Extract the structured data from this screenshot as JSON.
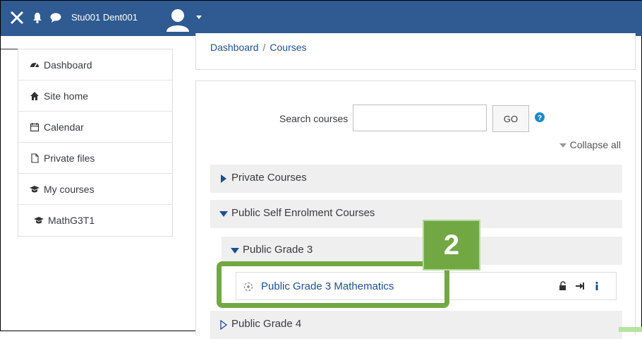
{
  "navbar": {
    "user_name": "Stu001 Dent001",
    "icons": [
      "close-icon",
      "bell-icon",
      "chat-icon",
      "avatar-icon",
      "caret-down-icon"
    ],
    "background": "#2f5a92"
  },
  "sidebar": {
    "items": [
      {
        "label": "Dashboard",
        "icon": "dashboard-icon"
      },
      {
        "label": "Site home",
        "icon": "home-icon"
      },
      {
        "label": "Calendar",
        "icon": "calendar-icon"
      },
      {
        "label": "Private files",
        "icon": "file-icon"
      },
      {
        "label": "My courses",
        "icon": "graduation-cap-icon"
      },
      {
        "label": "MathG3T1",
        "icon": "graduation-cap-icon"
      }
    ]
  },
  "breadcrumb": {
    "items": [
      "Dashboard",
      "Courses"
    ],
    "separator": "/"
  },
  "search": {
    "label": "Search courses",
    "value": "",
    "go_label": "GO"
  },
  "collapse_all": "Collapse all",
  "categories": [
    {
      "label": "Private Courses",
      "expanded": false
    },
    {
      "label": "Public Self Enrolment Courses",
      "expanded": true
    },
    {
      "label": "Public Grade 3",
      "expanded": true
    },
    {
      "label": "Public Grade 4",
      "expanded": false
    }
  ],
  "course": {
    "name": "Public Grade 3 Mathematics",
    "action_icons": [
      "unlock-icon",
      "enrol-icon",
      "info-icon"
    ]
  },
  "callout": {
    "number": "2",
    "color": "#71a844"
  },
  "colors": {
    "link": "#1d4f8f",
    "category_bg": "#efefef"
  }
}
